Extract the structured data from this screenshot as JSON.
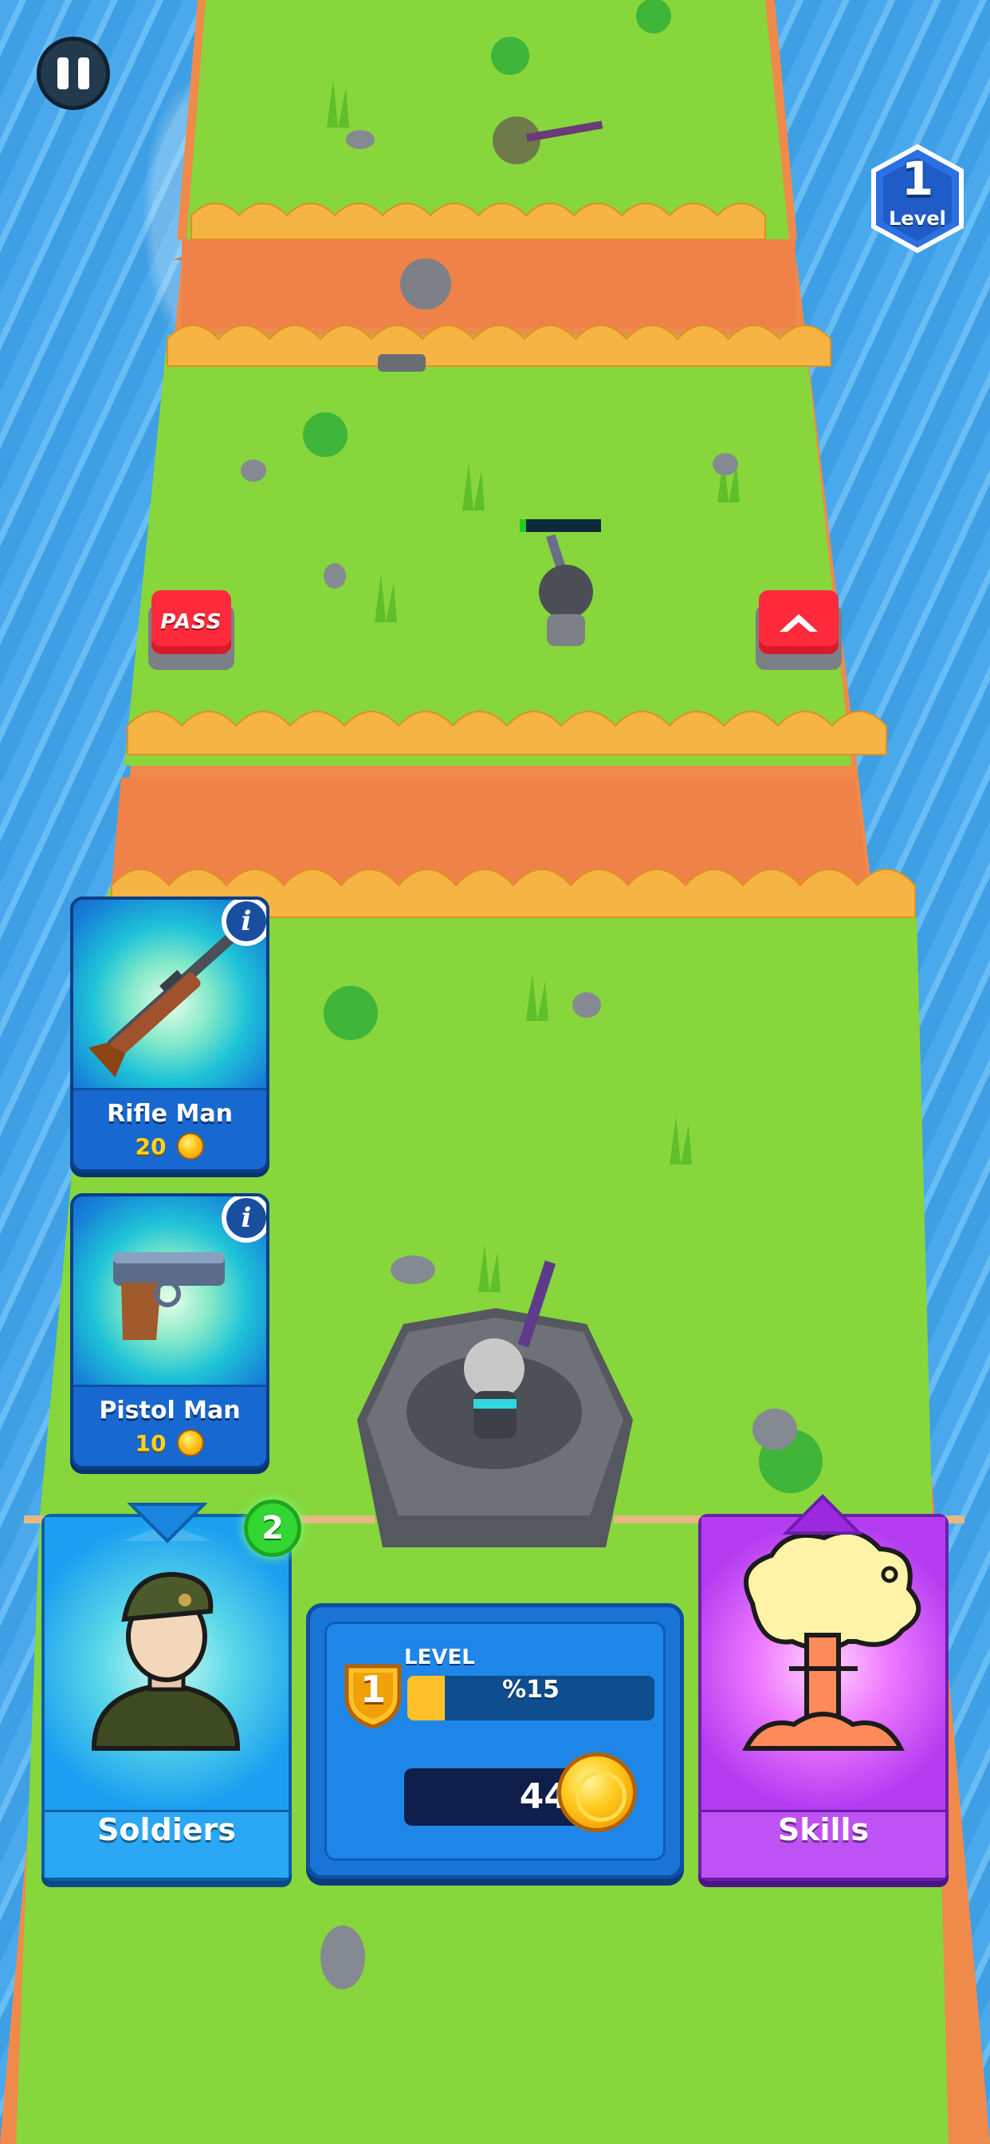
{
  "hud": {
    "pause_icon": "pause-icon",
    "level_number": "1",
    "level_label": "Level"
  },
  "field": {
    "pass_button_label": "PASS",
    "advance_button_icon": "chevron-up-icon"
  },
  "unit_cards": [
    {
      "name": "Rifle Man",
      "cost": "20",
      "icon": "rifle-icon"
    },
    {
      "name": "Pistol Man",
      "cost": "10",
      "icon": "pistol-icon"
    }
  ],
  "bottom_menu": {
    "soldiers_label": "Soldiers",
    "soldiers_badge": "2",
    "skills_label": "Skills",
    "level_title": "LEVEL",
    "level_number": "1",
    "level_progress_text": "%15",
    "level_progress": 0.15,
    "gold": "44"
  },
  "colors": {
    "grass": "#7fd23a",
    "cliff": "#f0874c",
    "card_blue": "#1768d0",
    "skills_purple": "#b33cf0",
    "button_red": "#ff2b3d",
    "coin_gold": "#ffc21a"
  }
}
